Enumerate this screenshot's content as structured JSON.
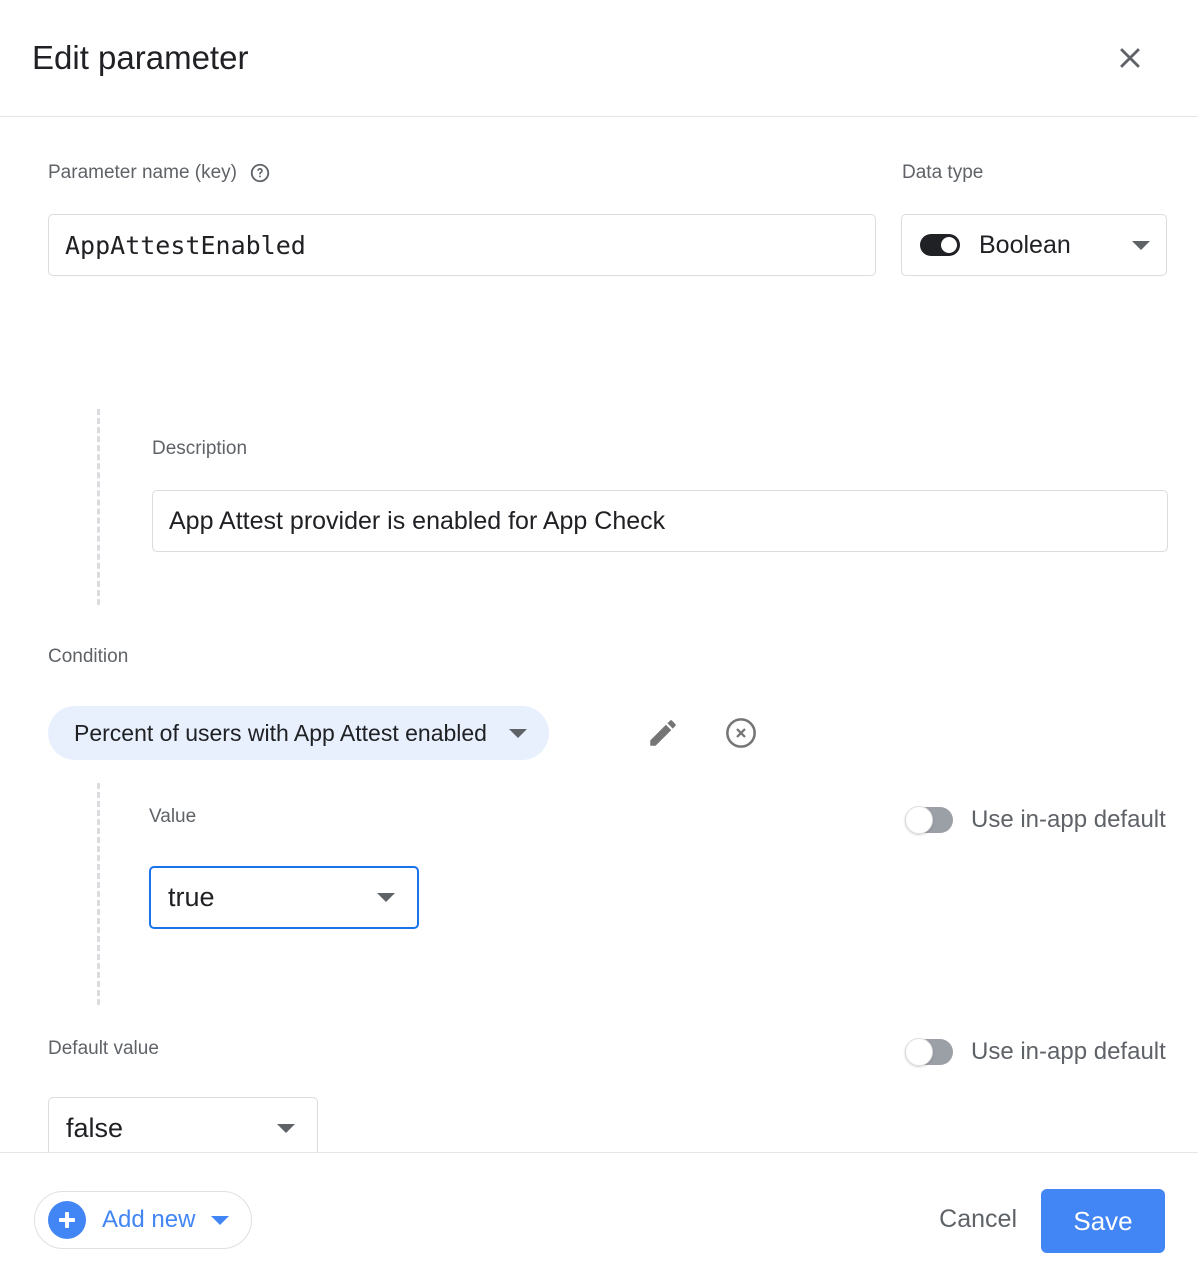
{
  "dialog": {
    "title": "Edit parameter",
    "close_icon": "close-icon"
  },
  "parameter": {
    "name_label": "Parameter name (key)",
    "help_icon": "help-circle-icon",
    "name_value": "AppAttestEnabled",
    "name_placeholder": "Parameter name (key)"
  },
  "data_type": {
    "label": "Data type",
    "selected": "Boolean",
    "toggle_icon": "boolean-toggle-icon",
    "caret_icon": "chevron-down-icon"
  },
  "description": {
    "label": "Description",
    "value": "App Attest provider is enabled for App Check",
    "placeholder": "Description"
  },
  "condition": {
    "label": "Condition",
    "chip_text": "Percent of users with App Attest enabled",
    "chip_caret_icon": "chevron-down-icon",
    "edit_icon": "pencil-icon",
    "remove_icon": "cancel-circle-icon"
  },
  "value_section": {
    "label": "Value",
    "selected": "true",
    "caret_icon": "chevron-down-icon",
    "inapp_toggle_label": "Use in-app default",
    "inapp_toggle_state": "off"
  },
  "default_value_section": {
    "label": "Default value",
    "selected": "false",
    "caret_icon": "chevron-down-icon",
    "inapp_toggle_label": "Use in-app default",
    "inapp_toggle_state": "off"
  },
  "footer": {
    "add_new_label": "Add new",
    "add_new_plus_icon": "plus-circle-icon",
    "add_new_caret_icon": "chevron-down-icon",
    "cancel_label": "Cancel",
    "save_label": "Save"
  },
  "colors": {
    "accent_blue": "#4285f4",
    "focus_blue": "#1a73e8",
    "chip_bg": "#e8f0fe",
    "text_primary": "#202124",
    "text_secondary": "#5f6368",
    "border": "#dadce0",
    "toggle_off": "#9aa0a6"
  }
}
